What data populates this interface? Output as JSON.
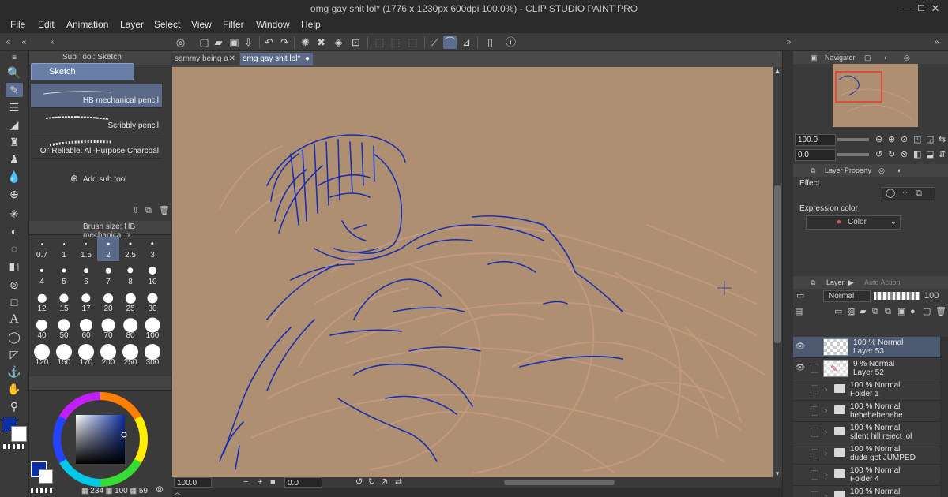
{
  "window": {
    "title": "omg gay shit lol* (1776 x 1230px 600dpi 100.0%)  -  CLIP STUDIO PAINT PRO",
    "buttons": [
      "minimize-icon",
      "maximize-icon",
      "close-icon"
    ]
  },
  "menu": [
    "File",
    "Edit",
    "Animation",
    "Layer",
    "Select",
    "View",
    "Filter",
    "Window",
    "Help"
  ],
  "subtool": {
    "header": "Sub Tool: Sketch",
    "group": "Sketch",
    "items": [
      "HB mechanical pencil",
      "Scribbly pencil",
      "Ol' Reliable: All-Purpose Charcoal"
    ],
    "add_label": "Add sub tool"
  },
  "brush_size": {
    "header": "Brush size: HB mechanical p",
    "sizes": [
      "0.7",
      "1",
      "1.5",
      "2",
      "2.5",
      "3",
      "4",
      "5",
      "6",
      "7",
      "8",
      "10",
      "12",
      "15",
      "17",
      "20",
      "25",
      "30",
      "40",
      "50",
      "60",
      "70",
      "80",
      "100",
      "120",
      "150",
      "170",
      "200",
      "250",
      "300"
    ],
    "selected": "2"
  },
  "color": {
    "main": "#0d2fa3",
    "sub": "#ffffff",
    "readout": [
      "234",
      "100",
      "59"
    ]
  },
  "tabs": [
    {
      "label": "sammy being a"
    },
    {
      "label": "omg gay shit lol*"
    }
  ],
  "status": {
    "zoom": "100.0",
    "angle": "0.0"
  },
  "navigator": {
    "label": "Navigator",
    "zoom": "100.0",
    "rotate": "0.0"
  },
  "layer_property": {
    "label": "Layer Property",
    "effect": "Effect",
    "expression_label": "Expression color",
    "expression_value": "Color"
  },
  "layers_panel": {
    "label": "Layer",
    "auto_action": "Auto Action",
    "blend_mode": "Normal",
    "opacity": "100",
    "layers": [
      {
        "opacity": "100 % Normal",
        "name": "Layer 53",
        "type": "raster",
        "active": true
      },
      {
        "opacity": "9 % Normal",
        "name": "Layer 52",
        "type": "raster",
        "active": false
      },
      {
        "opacity": "100 % Normal",
        "name": "Folder 1",
        "type": "folder",
        "active": false
      },
      {
        "opacity": "100 % Normal",
        "name": "hehehehehehe",
        "type": "folder",
        "active": false
      },
      {
        "opacity": "100 % Normal",
        "name": "silent hill reject lol",
        "type": "folder",
        "active": false
      },
      {
        "opacity": "100 % Normal",
        "name": "dude got JUMPED",
        "type": "folder",
        "active": false
      },
      {
        "opacity": "100 % Normal",
        "name": "Folder 4",
        "type": "folder",
        "active": false
      },
      {
        "opacity": "100 % Normal",
        "name": "",
        "type": "folder",
        "active": false
      }
    ]
  },
  "colors": {
    "canvas_bg": "#ae8f72",
    "sketch_blue": "#1b2fb0",
    "sketch_brown": "#c79a80",
    "accent": "#6a7fa8"
  }
}
